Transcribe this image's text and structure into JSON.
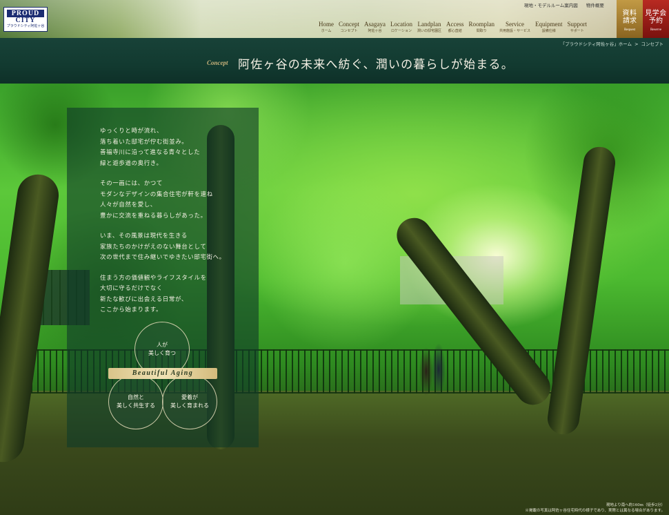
{
  "header": {
    "logo": {
      "brand": "PROUD",
      "brand2": "CITY",
      "sub": "プラウドシティ阿佐ヶ谷"
    },
    "utility_links": [
      "現地・モデルルーム案内図",
      "物件概要"
    ],
    "nav": [
      {
        "en": "Home",
        "jp": "ホーム"
      },
      {
        "en": "Concept",
        "jp": "コンセプト"
      },
      {
        "en": "Asagaya",
        "jp": "阿佐ヶ谷"
      },
      {
        "en": "Location",
        "jp": "ロケーション"
      },
      {
        "en": "Landplan",
        "jp": "潤いの邸宅園区"
      },
      {
        "en": "Access",
        "jp": "都心直結"
      },
      {
        "en": "Roomplan",
        "jp": "間取り"
      },
      {
        "en": "Service",
        "jp": "共用施設・サービス"
      },
      {
        "en": "Equipment",
        "jp": "設備仕様"
      },
      {
        "en": "Support",
        "jp": "サポート"
      }
    ],
    "cta_request": {
      "jp1": "資料",
      "jp2": "請求",
      "en": "Request"
    },
    "cta_reserve": {
      "jp1": "見学会",
      "jp2": "予約",
      "en": "Reserve"
    }
  },
  "breadcrumb": {
    "item1": "「プラウドシティ阿佐ヶ谷」ホーム",
    "sep": ">",
    "item2": "コンセプト"
  },
  "concept": {
    "label": "Concept",
    "title": "阿佐ヶ谷の未来へ紡ぐ、潤いの暮らしが始まる。"
  },
  "body_paragraphs": [
    [
      "ゆっくりと時が流れ、",
      "落ち着いた邸宅が佇む街並み。",
      "善福寺川に沿って進なる青々とした",
      "緑と遊歩道の奥行き。"
    ],
    [
      "その一画には、かつて",
      "モダンなデザインの集合住宅が軒を連ね",
      "人々が自然を愛し、",
      "豊かに交流を重ねる暮らしがあった。"
    ],
    [
      "いま、その風景は現代を生きる",
      "家族たちのかけがえのない舞台として",
      "次の世代まで住み継いでゆきたい邸宅街へ。"
    ],
    [
      "住まう方の価値観やライフスタイルを",
      "大切に守るだけでなく",
      "新たな歓びに出会える日常が、",
      "ここから始まります。"
    ]
  ],
  "circles": {
    "c1": [
      "人が",
      "美しく育つ"
    ],
    "c2": [
      "自然と",
      "美しく共生する"
    ],
    "c3": [
      "愛着が",
      "美しく育まれる"
    ]
  },
  "ribbon": "Beautiful Aging",
  "caption": [
    "現地より南へ約160m（徒歩2分）",
    "※掲載の写真は阿佐ヶ谷住宅時代の様子であり、実際とは異なる場合があります。"
  ]
}
